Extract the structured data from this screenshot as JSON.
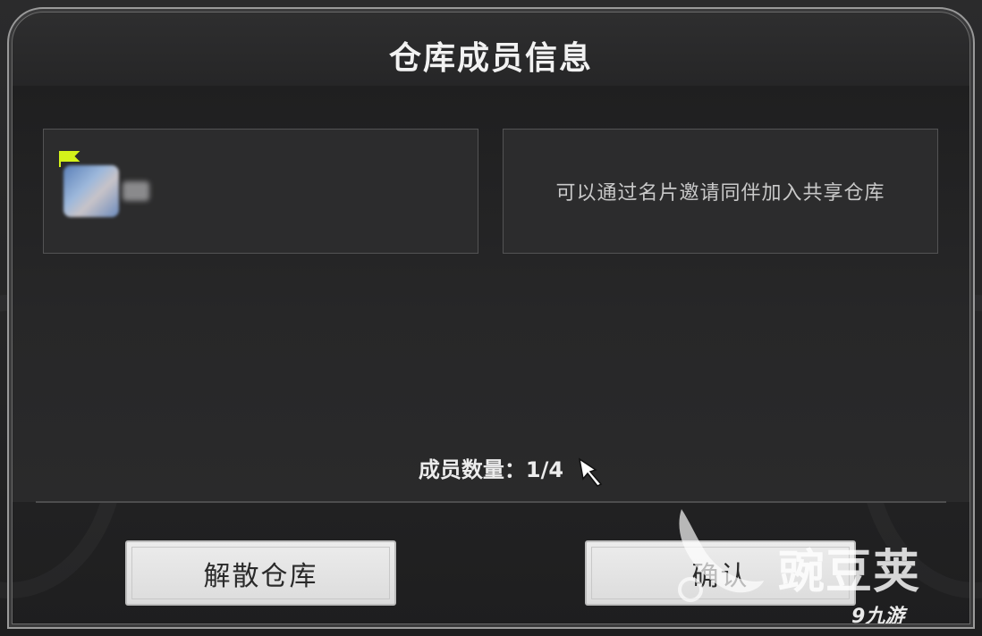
{
  "dialog": {
    "title": "仓库成员信息",
    "invite_text": "可以通过名片邀请同伴加入共享仓库",
    "member_count_label": "成员数量：",
    "member_count_value": "1/4"
  },
  "buttons": {
    "disband_label": "解散仓库",
    "confirm_label": "确认"
  },
  "watermark": {
    "brand": "豌豆荚",
    "secondary": "九游"
  },
  "colors": {
    "background": "#262627",
    "button": "#e6e6e6",
    "owner_flag": "#d4f21a"
  }
}
